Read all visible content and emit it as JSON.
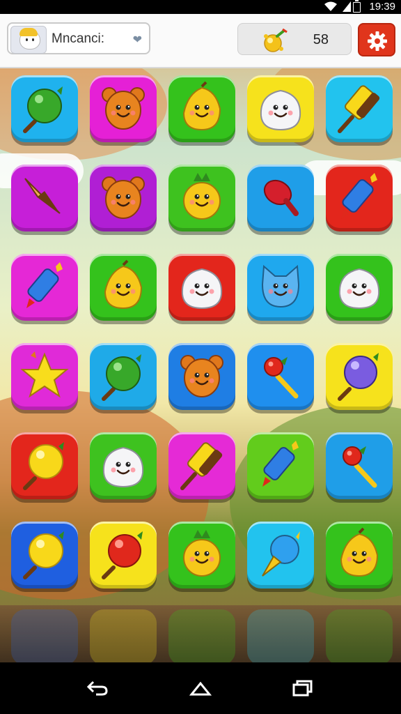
{
  "status_bar": {
    "time": "19:39"
  },
  "header": {
    "player_name": "Mncanci:",
    "score": "58"
  },
  "colors": {
    "settings_button": "#e0351c",
    "tile_palette": [
      "#1aa9e8",
      "#e01fd8",
      "#2fbf1a",
      "#f4e21a",
      "#9d28d8",
      "#e8231c",
      "#1f6fe0",
      "#58cc17"
    ]
  },
  "board": {
    "rows": [
      [
        {
          "color": "#1fb2ee",
          "item": "green-lollipop-icon"
        },
        {
          "color": "#e520d6",
          "item": "bear-face-icon"
        },
        {
          "color": "#34c21c",
          "item": "pear-face-icon"
        },
        {
          "color": "#f6e21c",
          "item": "white-blob-face-icon"
        },
        {
          "color": "#22c3ee",
          "item": "ice-pop-icon"
        }
      ],
      [
        {
          "color": "#c61fd8",
          "item": "ice-cream-cone-icon"
        },
        {
          "color": "#b01fd4",
          "item": "bear-face-icon"
        },
        {
          "color": "#3ec21f",
          "item": "pineapple-face-icon"
        },
        {
          "color": "#1f9ee8",
          "item": "meat-drumstick-icon"
        },
        {
          "color": "#e3261c",
          "item": "crayon-icon"
        }
      ],
      [
        {
          "color": "#e528d6",
          "item": "crayon-icon"
        },
        {
          "color": "#34c21c",
          "item": "pear-face-icon"
        },
        {
          "color": "#e3261c",
          "item": "white-blob-face-icon"
        },
        {
          "color": "#1fa8ee",
          "item": "cat-face-icon"
        },
        {
          "color": "#34c21c",
          "item": "white-blob-face-icon"
        }
      ],
      [
        {
          "color": "#e02ad8",
          "item": "star-icon"
        },
        {
          "color": "#1faae8",
          "item": "green-lollipop-icon"
        },
        {
          "color": "#1f7ee4",
          "item": "bear-face-icon"
        },
        {
          "color": "#1f8fee",
          "item": "cherry-rattle-icon"
        },
        {
          "color": "#f6e21c",
          "item": "purple-lollipop-icon"
        }
      ],
      [
        {
          "color": "#e3261c",
          "item": "yellow-lollipop-icon"
        },
        {
          "color": "#3ec21f",
          "item": "white-blob-face-icon"
        },
        {
          "color": "#e52ad6",
          "item": "ice-pop-icon"
        },
        {
          "color": "#62cc1c",
          "item": "crayon-icon"
        },
        {
          "color": "#1f9ee8",
          "item": "cherry-rattle-icon"
        }
      ],
      [
        {
          "color": "#1f5fe0",
          "item": "yellow-lollipop-icon"
        },
        {
          "color": "#f6e21c",
          "item": "red-lollipop-icon"
        },
        {
          "color": "#34c21c",
          "item": "pineapple-face-icon"
        },
        {
          "color": "#22c3ee",
          "item": "blue-cone-icon"
        },
        {
          "color": "#34c21c",
          "item": "pear-face-icon"
        }
      ]
    ]
  },
  "nav": {
    "back": "back-icon",
    "home": "home-icon",
    "recents": "recents-icon"
  }
}
